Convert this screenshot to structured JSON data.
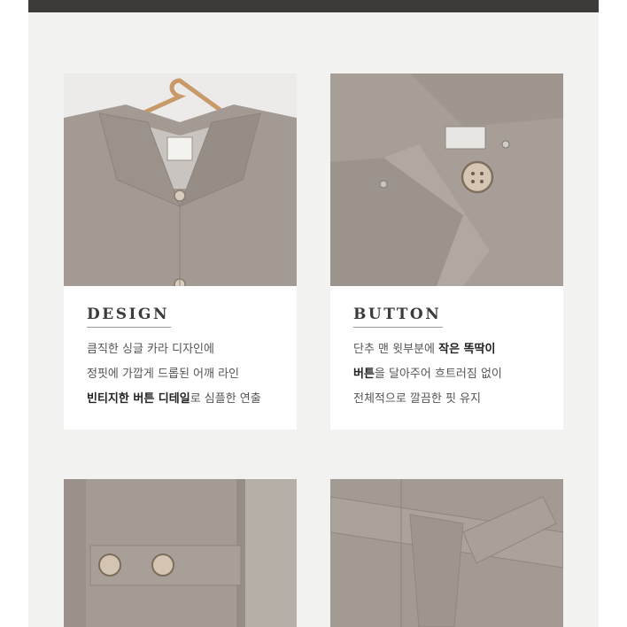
{
  "cards": [
    {
      "title": "DESIGN",
      "photo_icon": "coat-collar-hanger-photo",
      "lines": [
        {
          "pre": "큼직한 싱글 카라 디자인에",
          "bold": "",
          "post": ""
        },
        {
          "pre": "정핏에 가깝게 드롭된 어깨 라인",
          "bold": "",
          "post": ""
        },
        {
          "pre": "",
          "bold": "빈티지한 버튼 디테일",
          "post": "로 심플한 연출"
        }
      ]
    },
    {
      "title": "BUTTON",
      "photo_icon": "coat-button-closeup-photo",
      "lines": [
        {
          "pre": "단추 맨 윗부분에 ",
          "bold": "작은 똑딱이",
          "post": ""
        },
        {
          "pre": "",
          "bold": "버튼",
          "post": "을 달아주어 흐트러짐 없이"
        },
        {
          "pre": "전체적으로 깔끔한 핏 유지",
          "bold": "",
          "post": ""
        }
      ]
    }
  ],
  "bottom_photos": [
    "coat-pocket-buttons-photo",
    "coat-belt-tie-photo"
  ],
  "colors": {
    "wool": "#a39a93",
    "panel": "#f2f2f1",
    "topbar": "#3d3a37",
    "text": "#555555"
  }
}
